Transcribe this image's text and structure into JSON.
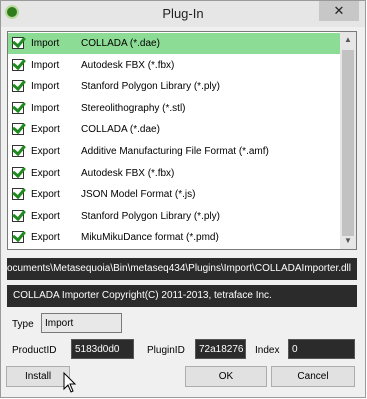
{
  "window": {
    "title": "Plug-In",
    "close_label": "✕"
  },
  "plugins": [
    {
      "kind": "Import",
      "format": "COLLADA (*.dae)",
      "checked": true,
      "selected": true
    },
    {
      "kind": "Import",
      "format": "Autodesk FBX (*.fbx)",
      "checked": true
    },
    {
      "kind": "Import",
      "format": "Stanford Polygon Library (*.ply)",
      "checked": true
    },
    {
      "kind": "Import",
      "format": "Stereolithography (*.stl)",
      "checked": true
    },
    {
      "kind": "Export",
      "format": "COLLADA (*.dae)",
      "checked": true
    },
    {
      "kind": "Export",
      "format": "Additive Manufacturing File Format (*.amf)",
      "checked": true
    },
    {
      "kind": "Export",
      "format": "Autodesk FBX (*.fbx)",
      "checked": true
    },
    {
      "kind": "Export",
      "format": "JSON Model Format (*.js)",
      "checked": true
    },
    {
      "kind": "Export",
      "format": "Stanford Polygon Library (*.ply)",
      "checked": true
    },
    {
      "kind": "Export",
      "format": "MikuMikuDance format (*.pmd)",
      "checked": true
    }
  ],
  "details": {
    "path": "ocuments\\Metasequoia\\Bin\\metaseq434\\Plugins\\Import\\COLLADAImporter.dll",
    "description": "COLLADA Importer   Copyright(C) 2011-2013, tetraface Inc.",
    "type_label": "Type",
    "type_value": "Import",
    "product_label": "ProductID",
    "product_value": "5183d0d0",
    "plugin_label": "PluginID",
    "plugin_value": "72a18276",
    "index_label": "Index",
    "index_value": "0"
  },
  "buttons": {
    "install": "Install",
    "ok": "OK",
    "cancel": "Cancel"
  },
  "colors": {
    "selected_row": "#8ddc96",
    "dark_field": "#2b2b2b"
  }
}
